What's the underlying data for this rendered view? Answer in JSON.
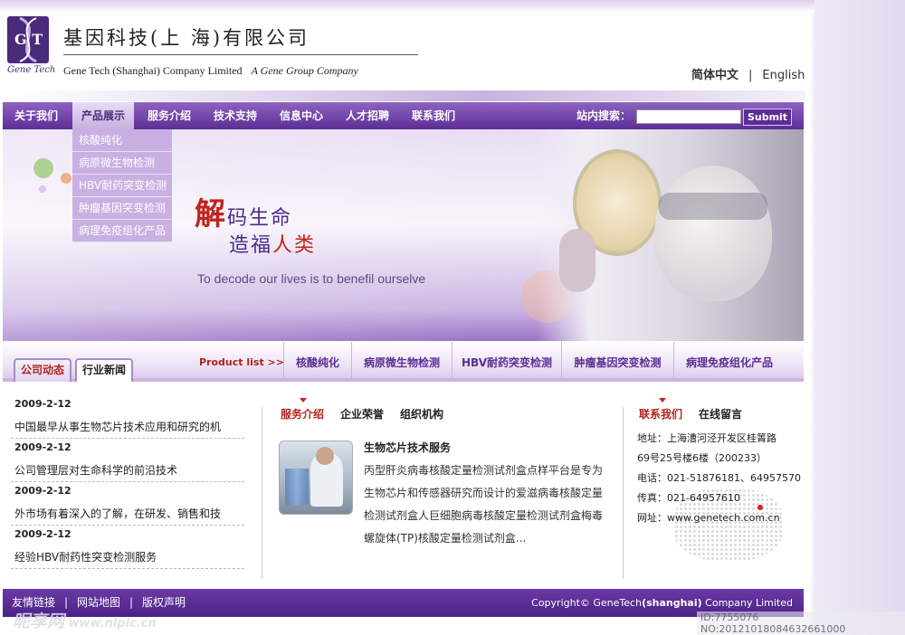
{
  "header": {
    "logo_letters": "G T",
    "logo_caption": "Gene Tech",
    "company_cn": "基因科技(上  海)有限公司",
    "company_en": "Gene Tech (Shanghai) Company Limited",
    "company_tagline": "A Gene Group Company",
    "lang_cn": "简体中文",
    "lang_sep": "|",
    "lang_en": "English"
  },
  "nav": {
    "items": [
      "关于我们",
      "产品展示",
      "服务介绍",
      "技术支持",
      "信息中心",
      "人才招聘",
      "联系我们"
    ],
    "active_index": 1,
    "search_label": "站内搜索：",
    "search_value": "",
    "submit_label": "Submit"
  },
  "dropdown": {
    "items": [
      "核酸纯化",
      "病原微生物检测",
      "HBV耐药突变检测",
      "肿瘤基因突变检测",
      "病理免疫组化产品"
    ]
  },
  "banner": {
    "slogan_big": "解",
    "slogan1_rest": "码生命",
    "slogan2_a": "造福",
    "slogan2_b": "人类",
    "english": "To decode our lives is to benefil ourselve"
  },
  "news_tabs": [
    "公司动态",
    "行业新闻"
  ],
  "product_list": {
    "label": "Product list  >>",
    "items": [
      "核酸纯化",
      "病原微生物检测",
      "HBV耐药突变检测",
      "肿瘤基因突变检测",
      "病理免疫组化产品"
    ]
  },
  "news": [
    {
      "date": "2009-2-12",
      "title": "中国最早从事生物芯片技术应用和研究的机"
    },
    {
      "date": "2009-2-12",
      "title": "公司管理层对生命科学的前沿技术"
    },
    {
      "date": "2009-2-12",
      "title": "外市场有着深入的了解，在研发、销售和技"
    },
    {
      "date": "2009-2-12",
      "title": "经验HBV耐药性突变检测服务"
    }
  ],
  "service": {
    "tabs": [
      "服务介绍",
      "企业荣誉",
      "组织机构"
    ],
    "title": "生物芯片技术服务",
    "lines": [
      "丙型肝炎病毒核酸定量检测试剂盒点样平台是专为",
      "生物芯片和传感器研究而设计的爱滋病毒核酸定量",
      "检测试剂盒人巨细胞病毒核酸定量检测试剂盒梅毒",
      "螺旋体(TP)核酸定量检测试剂盒..."
    ]
  },
  "contact": {
    "tabs": [
      "联系我们",
      "在线留言"
    ],
    "lines": [
      "地址：上海漕河泾开发区桂箐路",
      "69号25号楼6楼（200233）",
      "电话：021-51876181、64957570",
      "传真：021-64957610",
      "网址：www.genetech.com.cn"
    ]
  },
  "footer": {
    "links": [
      "友情链接",
      "网站地图",
      "版权声明"
    ],
    "sep": "|",
    "copyright_a": "Copyright© GeneTech",
    "copyright_b": "(shanghai)",
    "copyright_c": " Company Limited"
  },
  "watermark": {
    "brand": "昵享网",
    "url": " www.nipic.cn",
    "id": "ID:7755076 NO:20121018084632661000"
  },
  "colors": {
    "brand_purple": "#5c2e95",
    "accent_red": "#b0241e"
  }
}
